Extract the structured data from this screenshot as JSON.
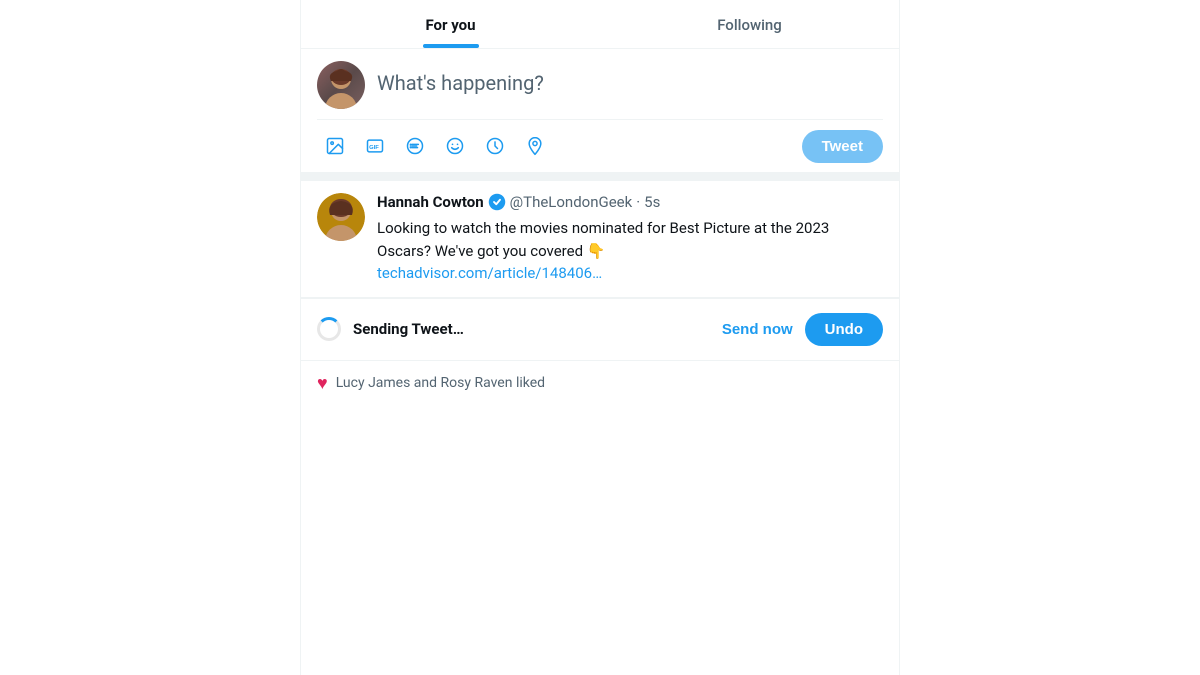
{
  "tabs": {
    "for_you": "For you",
    "following": "Following"
  },
  "compose": {
    "placeholder": "What's happening?",
    "tweet_button": "Tweet",
    "icons": [
      {
        "name": "image-icon",
        "label": "Image"
      },
      {
        "name": "gif-icon",
        "label": "GIF"
      },
      {
        "name": "poll-icon",
        "label": "Poll"
      },
      {
        "name": "emoji-icon",
        "label": "Emoji"
      },
      {
        "name": "schedule-icon",
        "label": "Schedule"
      },
      {
        "name": "location-icon",
        "label": "Location"
      }
    ]
  },
  "tweet": {
    "user_name": "Hannah Cowton",
    "user_handle": "@TheLondonGeek",
    "time_ago": "5s",
    "verified": true,
    "body": "Looking to watch the movies nominated for Best Picture at the 2023 Oscars? We've got you covered 👇",
    "link": "techadvisor.com/article/148406…",
    "link_href": "#"
  },
  "sending_bar": {
    "sending_text": "Sending Tweet…",
    "send_now_label": "Send now",
    "undo_label": "Undo"
  },
  "partial_bottom": {
    "text": "Lucy James and Rosy Raven"
  },
  "colors": {
    "active_tab_underline": "#1d9bf0",
    "blue": "#1d9bf0"
  }
}
